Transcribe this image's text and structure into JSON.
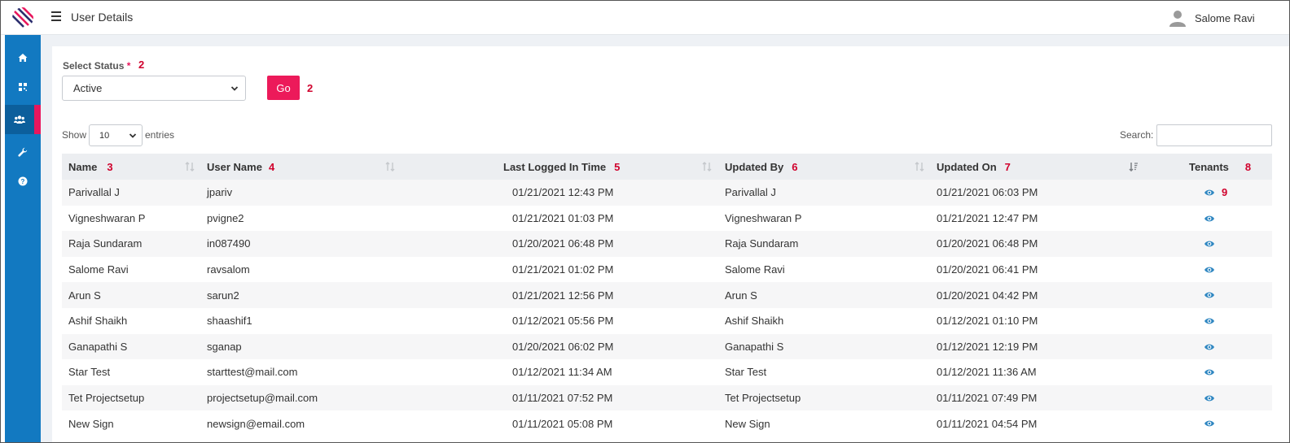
{
  "header": {
    "title": "User Details",
    "user_name": "Salome Ravi"
  },
  "sidebar": {
    "items": [
      {
        "icon": "home-icon"
      },
      {
        "icon": "qr-grid-icon"
      },
      {
        "icon": "users-icon",
        "active": true
      },
      {
        "icon": "wrench-icon"
      },
      {
        "icon": "help-circle-icon"
      }
    ]
  },
  "filter": {
    "label": "Select Status",
    "required_mark": "*",
    "selected": "Active",
    "go_label": "Go"
  },
  "annotations": {
    "status": "2",
    "go": "2",
    "name": "3",
    "username": "4",
    "last_logged": "5",
    "updated_by": "6",
    "updated_on": "7",
    "tenants": "8",
    "eye": "9"
  },
  "length_control": {
    "show": "Show",
    "value": "10",
    "entries": "entries"
  },
  "search": {
    "label": "Search:"
  },
  "table": {
    "columns": [
      "Name",
      "User Name",
      "Last Logged In Time",
      "Updated By",
      "Updated On",
      "Tenants"
    ],
    "rows": [
      [
        "Parivallal J",
        "jpariv",
        "01/21/2021 12:43 PM",
        "Parivallal J",
        "01/21/2021 06:03 PM"
      ],
      [
        "Vigneshwaran P",
        "pvigne2",
        "01/21/2021 01:03 PM",
        "Vigneshwaran P",
        "01/21/2021 12:47 PM"
      ],
      [
        "Raja Sundaram",
        "in087490",
        "01/20/2021 06:48 PM",
        "Raja Sundaram",
        "01/20/2021 06:48 PM"
      ],
      [
        "Salome Ravi",
        "ravsalom",
        "01/21/2021 01:02 PM",
        "Salome Ravi",
        "01/20/2021 06:41 PM"
      ],
      [
        "Arun S",
        "sarun2",
        "01/21/2021 12:56 PM",
        "Arun S",
        "01/20/2021 04:42 PM"
      ],
      [
        "Ashif Shaikh",
        "shaashif1",
        "01/12/2021 05:56 PM",
        "Ashif Shaikh",
        "01/12/2021 01:10 PM"
      ],
      [
        "Ganapathi S",
        "sganap",
        "01/20/2021 06:02 PM",
        "Ganapathi S",
        "01/12/2021 12:19 PM"
      ],
      [
        "Star Test",
        "starttest@mail.com",
        "01/12/2021 11:34 AM",
        "Star Test",
        "01/12/2021 11:36 AM"
      ],
      [
        "Tet Projectsetup",
        "projectsetup@mail.com",
        "01/11/2021 07:52 PM",
        "Tet Projectsetup",
        "01/11/2021 07:49 PM"
      ],
      [
        "New Sign",
        "newsign@email.com",
        "01/11/2021 05:08 PM",
        "New Sign",
        "01/11/2021 04:54 PM"
      ]
    ]
  },
  "colors": {
    "sidebar": "#1279c1",
    "accent": "#ec1a5a",
    "annotation": "#d0002c",
    "eye": "#2e86c1"
  }
}
